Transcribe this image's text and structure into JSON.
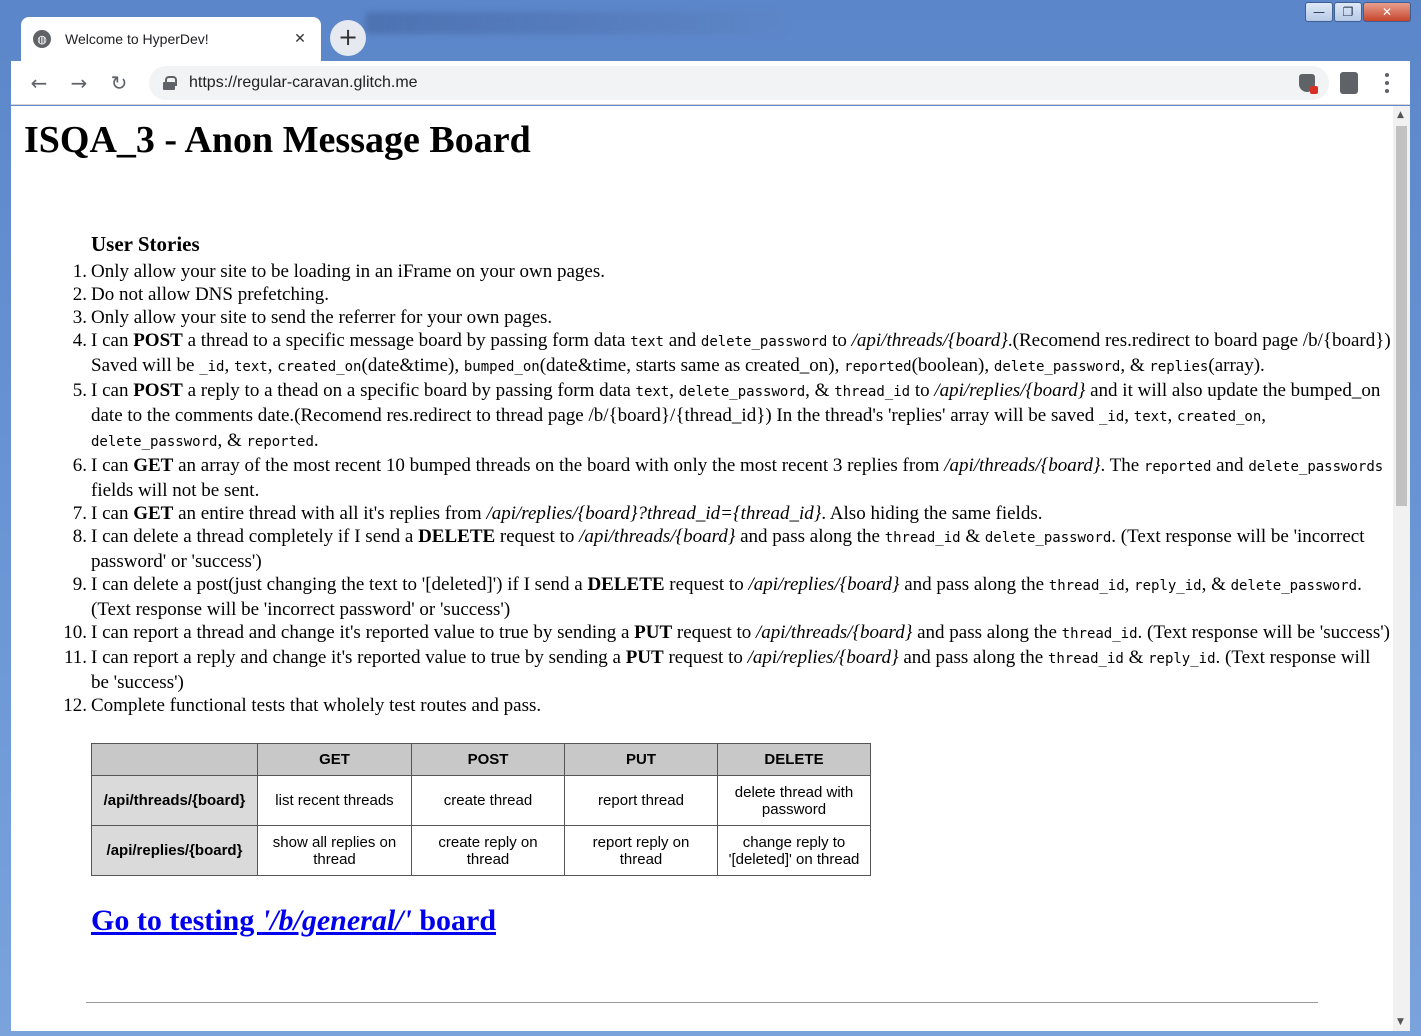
{
  "browser": {
    "tab_title": "Welcome to HyperDev!",
    "tab_close": "✕",
    "new_tab": "+",
    "url": "https://regular-caravan.glitch.me",
    "back": "←",
    "forward": "→",
    "reload": "↻",
    "win_min": "—",
    "win_max": "❐",
    "win_close": "✕"
  },
  "page": {
    "title": "ISQA_3 - Anon Message Board",
    "stories_heading": "User Stories",
    "stories": [
      {
        "n": "1.",
        "text": "Only allow your site to be loading in an iFrame on your own pages."
      },
      {
        "n": "2.",
        "text": "Do not allow DNS prefetching."
      },
      {
        "n": "3.",
        "text": "Only allow your site to send the referrer for your own pages."
      },
      {
        "n": "4.",
        "text": ""
      },
      {
        "n": "5.",
        "text": ""
      },
      {
        "n": "6.",
        "text": ""
      },
      {
        "n": "7.",
        "text": ""
      },
      {
        "n": "8.",
        "text": ""
      },
      {
        "n": "9.",
        "text": ""
      },
      {
        "n": "10.",
        "text": ""
      },
      {
        "n": "11.",
        "text": ""
      },
      {
        "n": "12.",
        "text": "Complete functional tests that wholely test routes and pass."
      }
    ],
    "s4": {
      "a": "I can ",
      "b": "POST",
      "c": " a thread to a specific message board by passing form data ",
      "code1": "text",
      "d": " and ",
      "code2": "delete_password",
      "e": " to ",
      "i1": "/api/threads/{board}",
      "f": ".(Recomend res.redirect to board page /b/{board}) Saved will be ",
      "code3": "_id",
      "g": ", ",
      "code4": "text",
      "h": ", ",
      "code5": "created_on",
      "j": "(date&time), ",
      "code6": "bumped_on",
      "k": "(date&time, starts same as created_on), ",
      "code7": "reported",
      "l": "(boolean), ",
      "code8": "delete_password",
      "m": ", & ",
      "code9": "replies",
      "n": "(array)."
    },
    "s5": {
      "a": "I can ",
      "b": "POST",
      "c": " a reply to a thead on a specific board by passing form data ",
      "code1": "text",
      "d": ", ",
      "code2": "delete_password",
      "e": ", & ",
      "code3": "thread_id",
      "f": " to ",
      "i1": "/api/replies/{board}",
      "g": " and it will also update the bumped_on date to the comments date.(Recomend res.redirect to thread page /b/{board}/{thread_id}) In the thread's 'replies' array will be saved ",
      "code4": "_id",
      "h": ", ",
      "code5": "text",
      "j": ", ",
      "code6": "created_on",
      "k": ", ",
      "code7": "delete_password",
      "l": ", & ",
      "code8": "reported",
      "m": "."
    },
    "s6": {
      "a": "I can ",
      "b": "GET",
      "c": " an array of the most recent 10 bumped threads on the board with only the most recent 3 replies from ",
      "i1": "/api/threads/{board}",
      "d": ". The ",
      "code1": "reported",
      "e": " and ",
      "code2": "delete_passwords",
      "f": " fields will not be sent."
    },
    "s7": {
      "a": "I can ",
      "b": "GET",
      "c": " an entire thread with all it's replies from ",
      "i1": "/api/replies/{board}?thread_id={thread_id}",
      "d": ". Also hiding the same fields."
    },
    "s8": {
      "a": "I can delete a thread completely if I send a ",
      "b": "DELETE",
      "c": " request to ",
      "i1": "/api/threads/{board}",
      "d": " and pass along the ",
      "code1": "thread_id",
      "e": " & ",
      "code2": "delete_password",
      "f": ". (Text response will be 'incorrect password' or 'success')"
    },
    "s9": {
      "a": "I can delete a post(just changing the text to '[deleted]') if I send a ",
      "b": "DELETE",
      "c": " request to ",
      "i1": "/api/replies/{board}",
      "d": " and pass along the ",
      "code1": "thread_id",
      "e": ", ",
      "code2": "reply_id",
      "f": ", & ",
      "code3": "delete_password",
      "g": ". (Text response will be 'incorrect password' or 'success')"
    },
    "s10": {
      "a": "I can report a thread and change it's reported value to true by sending a ",
      "b": "PUT",
      "c": " request to ",
      "i1": "/api/threads/{board}",
      "d": " and pass along the ",
      "code1": "thread_id",
      "e": ". (Text response will be 'success')"
    },
    "s11": {
      "a": "I can report a reply and change it's reported value to true by sending a ",
      "b": "PUT",
      "c": " request to ",
      "i1": "/api/replies/{board}",
      "d": " and pass along the ",
      "code1": "thread_id",
      "e": " & ",
      "code2": "reply_id",
      "f": ". (Text response will be 'success')"
    },
    "table": {
      "headers": [
        "",
        "GET",
        "POST",
        "PUT",
        "DELETE"
      ],
      "rows": [
        [
          "/api/threads/{board}",
          "list recent threads",
          "create thread",
          "report thread",
          "delete thread with password"
        ],
        [
          "/api/replies/{board}",
          "show all replies on thread",
          "create reply on thread",
          "report reply on thread",
          "change reply to '[deleted]' on thread"
        ]
      ]
    },
    "link": {
      "a": "Go to testing ",
      "i": "'/b/general/'",
      "b": " board"
    }
  }
}
